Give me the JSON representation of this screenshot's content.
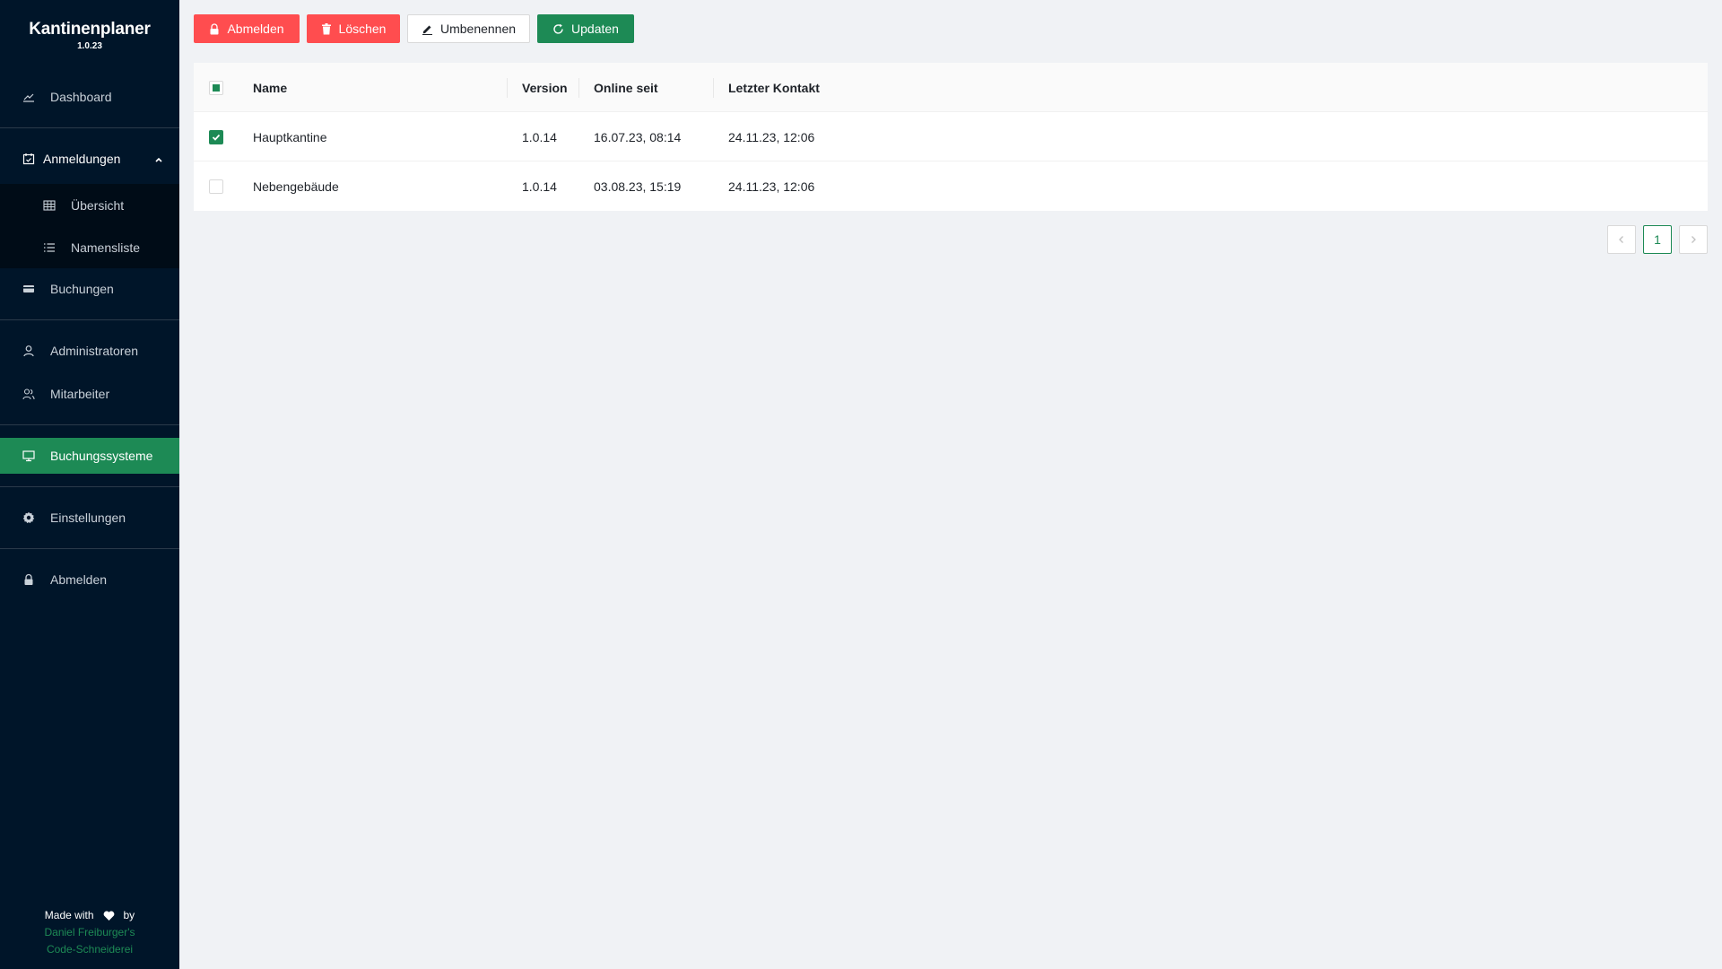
{
  "app": {
    "name": "Kantinenplaner",
    "version": "1.0.23"
  },
  "sidebar": {
    "dashboard": "Dashboard",
    "registrations": "Anmeldungen",
    "overview": "Übersicht",
    "name_list": "Namensliste",
    "bookings": "Buchungen",
    "administrators": "Administratoren",
    "employees": "Mitarbeiter",
    "booking_systems": "Buchungssysteme",
    "settings": "Einstellungen",
    "logout": "Abmelden"
  },
  "footer": {
    "made_with": "Made with",
    "by": "by",
    "author_line1": "Daniel Freiburger's",
    "author_line2": "Code-Schneiderei"
  },
  "toolbar": {
    "logout": "Abmelden",
    "delete": "Löschen",
    "rename": "Umbenennen",
    "update": "Updaten"
  },
  "table": {
    "columns": {
      "name": "Name",
      "version": "Version",
      "online_since": "Online seit",
      "last_contact": "Letzter Kontakt"
    },
    "rows": [
      {
        "checked": true,
        "name": "Hauptkantine",
        "version": "1.0.14",
        "online_since": "16.07.23, 08:14",
        "last_contact": "24.11.23, 12:06"
      },
      {
        "checked": false,
        "name": "Nebengebäude",
        "version": "1.0.14",
        "online_since": "03.08.23, 15:19",
        "last_contact": "24.11.23, 12:06"
      }
    ]
  },
  "pagination": {
    "current": "1"
  },
  "colors": {
    "sidebar_bg": "#001529",
    "accent": "#1d8a55",
    "danger": "#ff4d4f"
  }
}
